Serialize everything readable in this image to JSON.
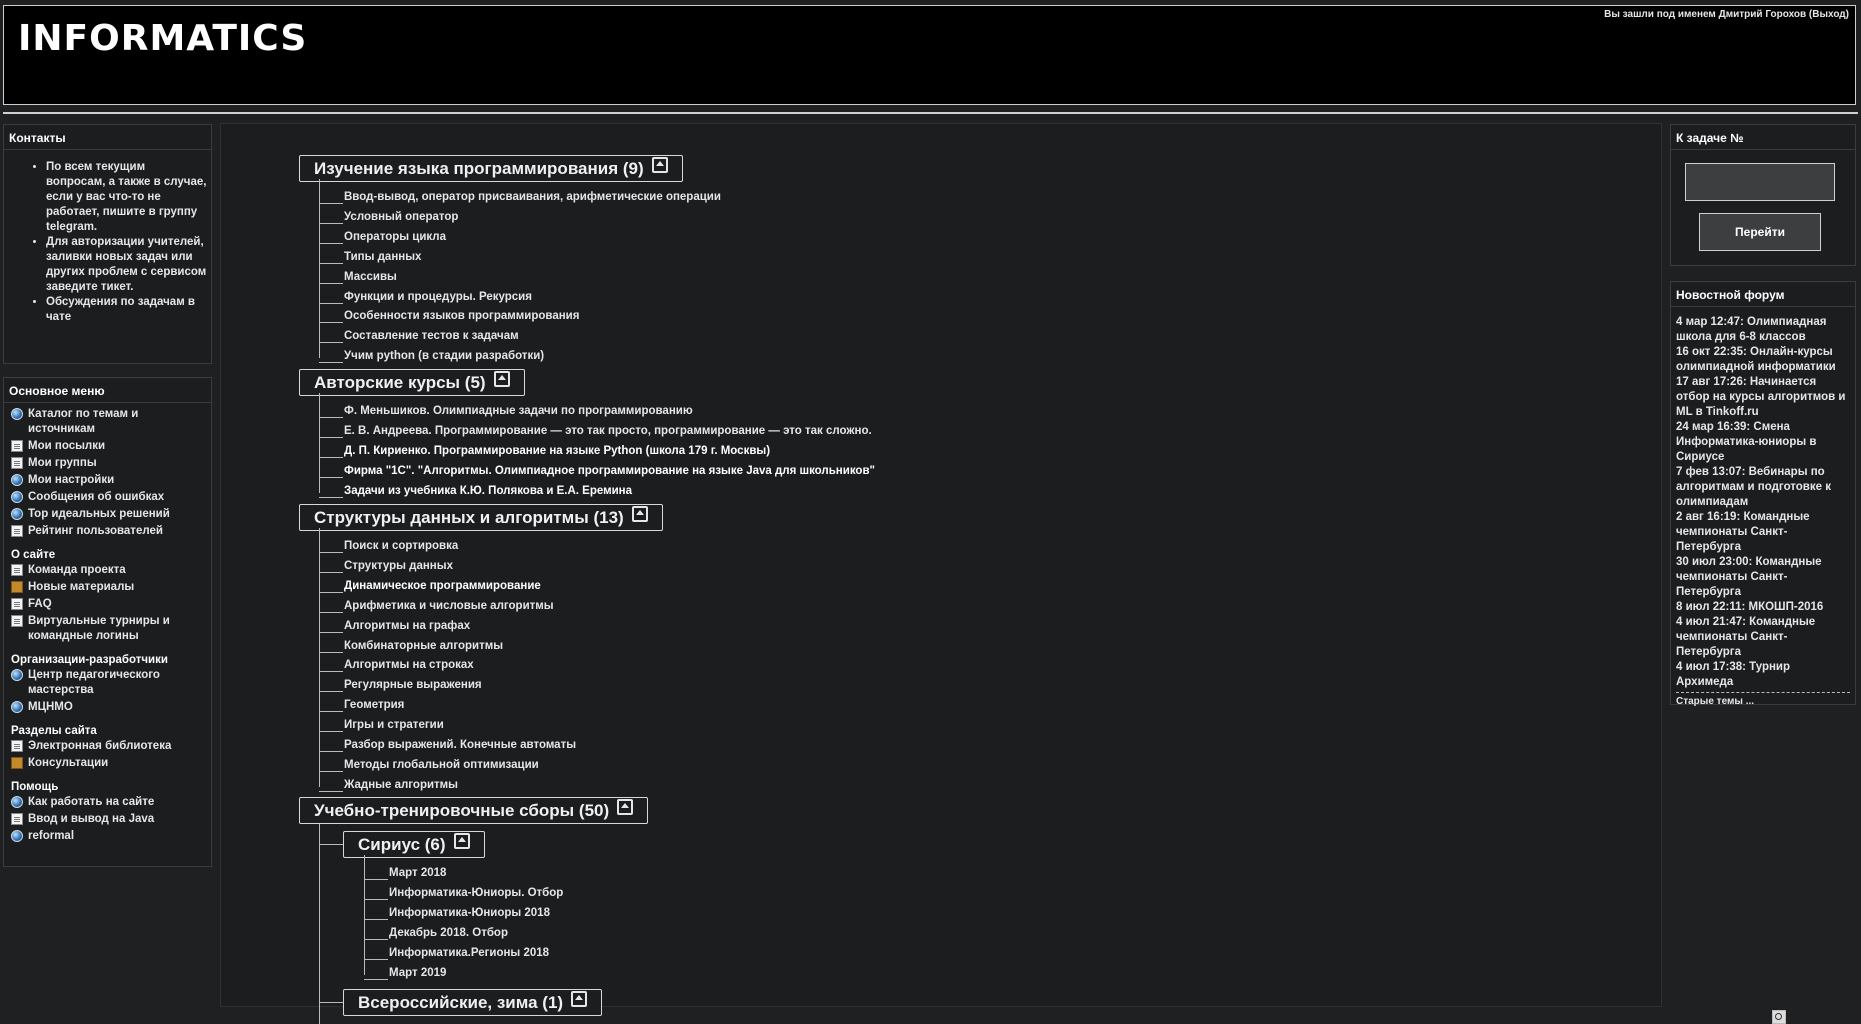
{
  "header": {
    "logo": "INFORMATICS",
    "login_text": "Вы зашли под именем Дмитрий Горохов (Выход)"
  },
  "contacts": {
    "title": "Контакты",
    "items": [
      "По всем текущим вопросам, а также в случае, если у вас что-то не работает, пишите в группу telegram.",
      "Для авторизации учителей, заливки новых задач или других проблем с сервисом заведите тикет.",
      "Обсуждения по задачам в чате"
    ]
  },
  "main_menu": {
    "title": "Основное меню",
    "items": [
      {
        "label": "Каталог по темам и источникам",
        "icon": "globe"
      },
      {
        "label": "Мои посылки",
        "icon": "doc"
      },
      {
        "label": "Мои группы",
        "icon": "doc"
      },
      {
        "label": "Мои настройки",
        "icon": "globe"
      },
      {
        "label": "Сообщения об ошибках",
        "icon": "globe"
      },
      {
        "label": "Top идеальных решений",
        "icon": "globe"
      },
      {
        "label": "Рейтинг пользователей",
        "icon": "doc"
      }
    ],
    "about_title": "О сайте",
    "about": [
      {
        "label": "Команда проекта",
        "icon": "doc"
      },
      {
        "label": "Новые материалы",
        "icon": "box"
      },
      {
        "label": "FAQ",
        "icon": "doc"
      },
      {
        "label": "Виртуальные турниры и командные логины",
        "icon": "doc"
      }
    ],
    "orgs_title": "Организации-разработчики",
    "orgs": [
      {
        "label": "Центр педагогического мастерства",
        "icon": "globe"
      },
      {
        "label": "МЦНМО",
        "icon": "globe"
      }
    ],
    "sections_title": "Разделы сайта",
    "sections": [
      {
        "label": "Электронная библиотека",
        "icon": "doc"
      },
      {
        "label": "Консультации",
        "icon": "box"
      }
    ],
    "help_title": "Помощь",
    "help": [
      {
        "label": "Как работать на сайте",
        "icon": "globe"
      },
      {
        "label": "Ввод и вывод на Java",
        "icon": "doc"
      },
      {
        "label": "reformal",
        "icon": "globe"
      }
    ]
  },
  "tree": {
    "categories": [
      {
        "title": "Изучение языка программирования (9)",
        "items": [
          "Ввод-вывод, оператор присваивания, арифметические операции",
          "Условный оператор",
          "Операторы цикла",
          "Типы данных",
          "Массивы",
          "Функции и процедуры. Рекурсия",
          "Особенности языков программирования",
          "Составление тестов к задачам",
          "Учим python (в стадии разработки)"
        ]
      },
      {
        "title": "Авторские курсы (5)",
        "items": [
          "Ф. Меньшиков. Олимпиадные задачи по программированию",
          "Е. В. Андреева. Программирование — это так просто, программирование — это так сложно.",
          "Д. П. Кириенко. Программирование на языке Python (школа 179 г. Москвы)",
          "Фирма \"1С\". \"Алгоритмы. Олимпиадное программирование на языке Java для школьников\"",
          "Задачи из учебника К.Ю. Полякова и Е.А. Еремина"
        ]
      },
      {
        "title": "Структуры данных и алгоритмы (13)",
        "items": [
          "Поиск и сортировка",
          "Структуры данных",
          "Динамическое программирование",
          "Арифметика и числовые алгоритмы",
          "Алгоритмы на графах",
          "Комбинаторные алгоритмы",
          "Алгоритмы на строках",
          "Регулярные выражения",
          "Геометрия",
          "Игры и стратегии",
          "Разбор выражений. Конечные автоматы",
          "Методы глобальной оптимизации",
          "Жадные алгоритмы"
        ]
      },
      {
        "title": "Учебно-тренировочные сборы (50)",
        "subcategories": [
          {
            "title": "Сириус (6)",
            "items": [
              "Март 2018",
              "Информатика-Юниоры. Отбор",
              "Информатика-Юниоры 2018",
              "Декабрь 2018. Отбор",
              "Информатика.Регионы 2018",
              "Март 2019"
            ]
          },
          {
            "title": "Всероссийские, зима (1)"
          }
        ]
      }
    ]
  },
  "goto": {
    "title": "К задаче №",
    "button": "Перейти"
  },
  "news": {
    "title": "Новостной форум",
    "items": [
      "4 мар 12:47: Олимпиадная школа для 6-8 классов",
      "16 окт 22:35: Онлайн-курсы олимпиадной информатики",
      "17 авг 17:26: Начинается отбор на курсы алгоритмов и ML в Tinkoff.ru",
      "24 мар 16:39: Смена Информатика-юниоры в Сириусе",
      "7 фев 13:07: Вебинары по алгоритмам и подготовке к олимпиадам",
      "2 авг 16:19: Командные чемпионаты Санкт-Петербурга",
      "30 июл 23:00: Командные чемпионаты Санкт-Петербурга",
      "8 июл 22:11: МКОШП-2016",
      "4 июл 21:47: Командные чемпионаты Санкт-Петербурга",
      "4 июл 17:38: Турнир Архимеда"
    ],
    "more": "Старые темы ..."
  }
}
